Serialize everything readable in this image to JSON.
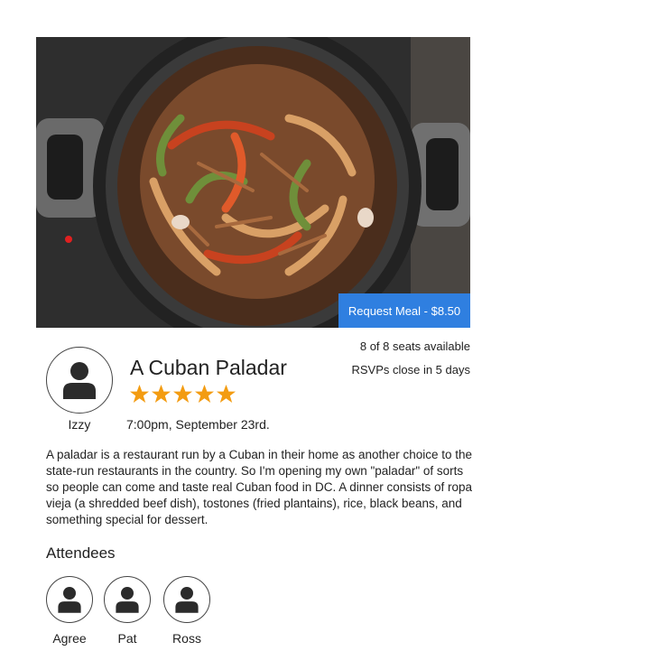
{
  "meal": {
    "request_label": "Request Meal - $8.50",
    "seats": "8 of 8 seats available",
    "rsvp": "RSVPs close in 5 days",
    "title": "A Cuban Paladar",
    "rating": 5,
    "datetime": "7:00pm, September 23rd.",
    "description": "A paladar is a restaurant run by a Cuban in their home as another choice to the state-run restaurants in the country. So I'm opening my own \"paladar\" of sorts so people can come and taste real Cuban food in DC. A dinner consists of ropa vieja (a shredded beef dish), tostones (fried plantains), rice, black beans, and something special for dessert."
  },
  "host": {
    "name": "Izzy",
    "icon": "user-icon"
  },
  "attendees": {
    "heading": "Attendees",
    "list": [
      {
        "name": "Agree",
        "icon": "user-icon"
      },
      {
        "name": "Pat",
        "icon": "user-icon"
      },
      {
        "name": "Ross",
        "icon": "user-icon"
      }
    ]
  },
  "colors": {
    "accent": "#2f7fe0",
    "star": "#f39c12"
  }
}
